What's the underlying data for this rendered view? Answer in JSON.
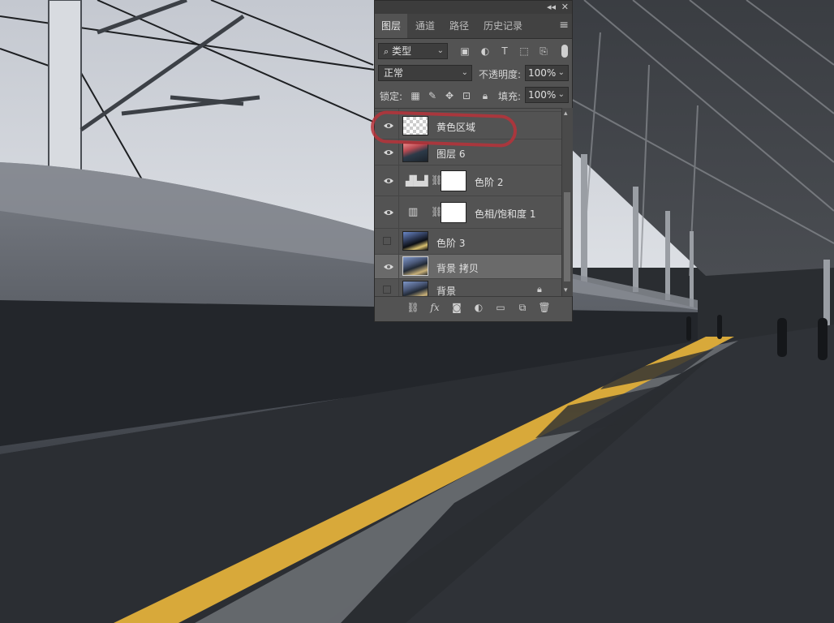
{
  "panel": {
    "top_controls": {
      "collapse": "◂◂",
      "close": "✕"
    },
    "tabs": [
      {
        "label": "图层",
        "active": true
      },
      {
        "label": "通道",
        "active": false
      },
      {
        "label": "路径",
        "active": false
      },
      {
        "label": "历史记录",
        "active": false
      }
    ],
    "filter": {
      "label": "类型"
    },
    "blend_mode": "正常",
    "opacity_label": "不透明度:",
    "opacity_value": "100%",
    "lock_label": "锁定:",
    "fill_label": "填充:",
    "fill_value": "100%",
    "layers": [
      {
        "name": "黄色区域",
        "visible": true,
        "selected": false
      },
      {
        "name": "图层 6",
        "visible": true,
        "selected": false
      },
      {
        "name": "色阶 2",
        "visible": true,
        "selected": false
      },
      {
        "name": "色相/饱和度 1",
        "visible": true,
        "selected": false
      },
      {
        "name": "色阶 3",
        "visible": false,
        "selected": false
      },
      {
        "name": "背景 拷贝",
        "visible": true,
        "selected": true
      },
      {
        "name": "背景",
        "visible": false,
        "selected": false
      }
    ]
  },
  "colors": {
    "panel_bg": "#535353",
    "selected_layer": "#6a6a6a",
    "tactile_strip": "#d8a93a",
    "annotation": "#b8323a"
  }
}
